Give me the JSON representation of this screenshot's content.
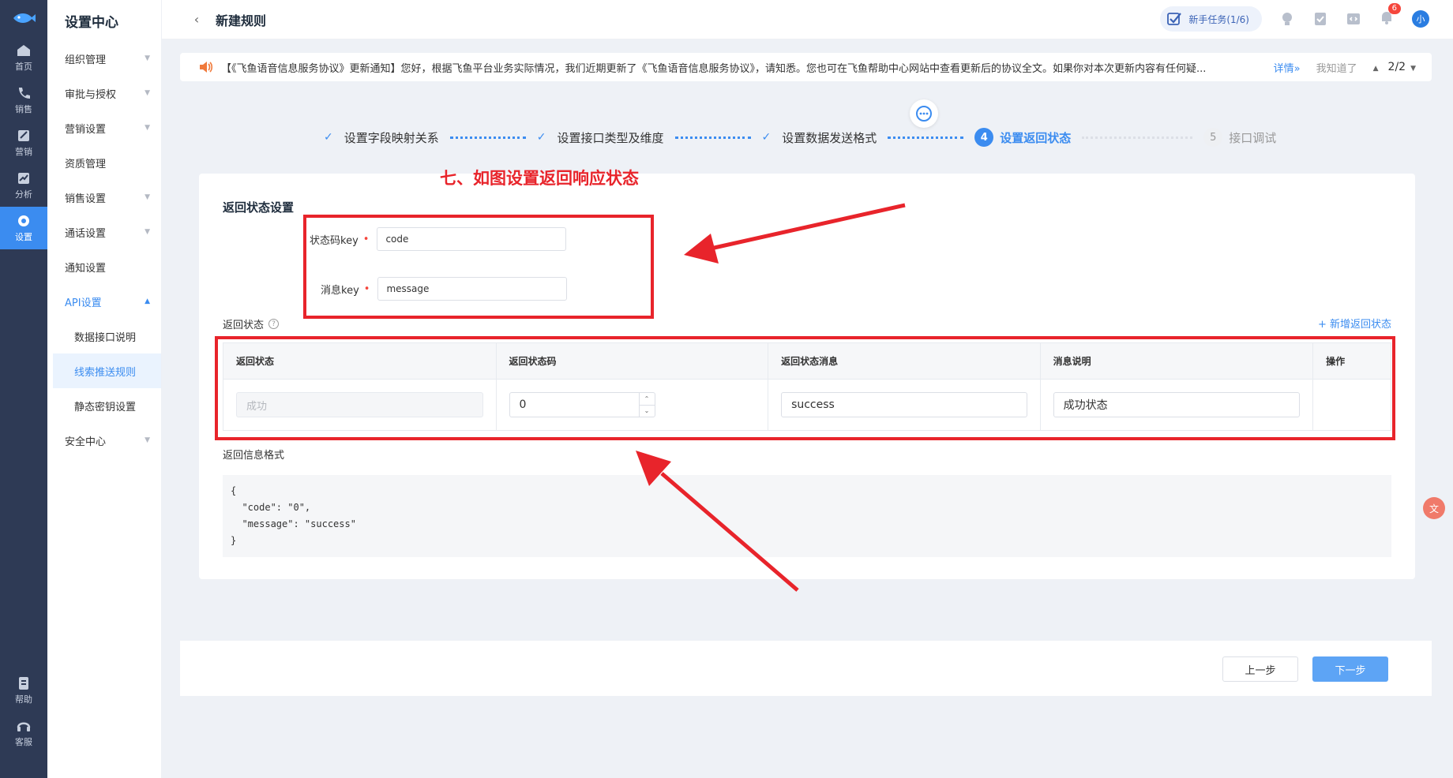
{
  "rail": {
    "items": [
      {
        "label": "首页",
        "icon": "home-icon"
      },
      {
        "label": "销售",
        "icon": "phone-icon"
      },
      {
        "label": "营销",
        "icon": "marketing-icon"
      },
      {
        "label": "分析",
        "icon": "chart-icon"
      },
      {
        "label": "设置",
        "icon": "gear-icon"
      }
    ],
    "bottom": [
      {
        "label": "帮助",
        "icon": "help-book-icon"
      },
      {
        "label": "客服",
        "icon": "headset-icon"
      }
    ]
  },
  "sidebar": {
    "title": "设置中心",
    "items": [
      {
        "label": "组织管理"
      },
      {
        "label": "审批与授权"
      },
      {
        "label": "营销设置"
      },
      {
        "label": "资质管理"
      },
      {
        "label": "销售设置"
      },
      {
        "label": "通话设置"
      },
      {
        "label": "通知设置"
      },
      {
        "label": "API设置"
      }
    ],
    "sub": [
      {
        "label": "数据接口说明"
      },
      {
        "label": "线索推送规则"
      },
      {
        "label": "静态密钥设置"
      }
    ],
    "last": {
      "label": "安全中心"
    }
  },
  "header": {
    "title": "新建规则",
    "task": "新手任务(1/6)",
    "badge": "6",
    "avatar": "小"
  },
  "notice": {
    "text": "【《飞鱼语音信息服务协议》更新通知】您好，根据飞鱼平台业务实际情况，我们近期更新了《飞鱼语音信息服务协议》，请知悉。您也可在飞鱼帮助中心网站中查看更新后的协议全文。如果你对本次更新内容有任何疑...",
    "detail": "详情»",
    "ok": "我知道了",
    "page": "2/2"
  },
  "steps": [
    {
      "label": "设置字段映射关系",
      "state": "done"
    },
    {
      "label": "设置接口类型及维度",
      "state": "done"
    },
    {
      "label": "设置数据发送格式",
      "state": "done"
    },
    {
      "num": "4",
      "label": "设置返回状态",
      "state": "active"
    },
    {
      "num": "5",
      "label": "接口调试",
      "state": "todo"
    }
  ],
  "form": {
    "section_title": "返回状态设置",
    "status_key_label": "状态码key",
    "status_key_value": "code",
    "msg_key_label": "消息key",
    "msg_key_value": "message",
    "req_mark": "•",
    "return_status_label": "返回状态",
    "help_glyph": "?",
    "add_link": "+ 新增返回状态",
    "table": {
      "headers": [
        "返回状态",
        "返回状态码",
        "返回状态消息",
        "消息说明",
        "操作"
      ],
      "row": {
        "status": "成功",
        "code": "0",
        "message": "success",
        "desc": "成功状态"
      }
    },
    "format_label": "返回信息格式",
    "format_code": "{\n  \"code\": \"0\",\n  \"message\": \"success\"\n}"
  },
  "buttons": {
    "prev": "上一步",
    "next": "下一步"
  },
  "annotation": {
    "text": "七、如图设置返回响应状态",
    "color": "#e8242b"
  },
  "colors": {
    "accent": "#3b8cf0",
    "rail": "#2e3a55"
  }
}
